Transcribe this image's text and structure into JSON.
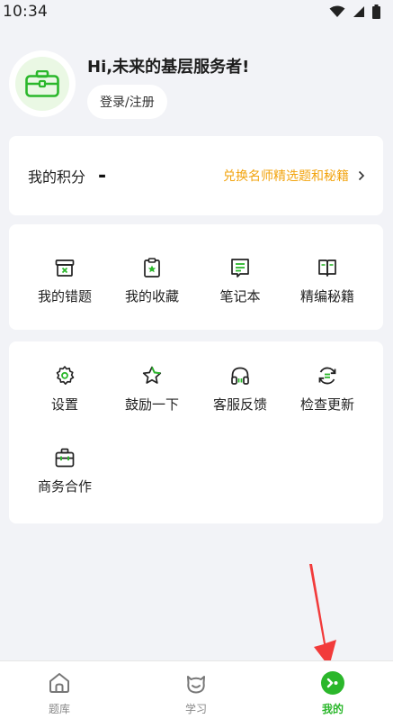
{
  "status": {
    "time": "10:34"
  },
  "profile": {
    "greeting": "Hi,未来的基层服务者!",
    "login_label": "登录/注册"
  },
  "points": {
    "label": "我的积分",
    "value": "-",
    "link": "兑换名师精选题和秘籍"
  },
  "tools": [
    {
      "label": "我的错题",
      "icon": "wrong-question-box-icon"
    },
    {
      "label": "我的收藏",
      "icon": "favorite-clipboard-icon"
    },
    {
      "label": "笔记本",
      "icon": "notebook-icon"
    },
    {
      "label": "精编秘籍",
      "icon": "open-book-icon"
    }
  ],
  "settings": [
    {
      "label": "设置",
      "icon": "gear-icon"
    },
    {
      "label": "鼓励一下",
      "icon": "star-icon"
    },
    {
      "label": "客服反馈",
      "icon": "headphones-icon"
    },
    {
      "label": "检查更新",
      "icon": "refresh-update-icon"
    },
    {
      "label": "商务合作",
      "icon": "briefcase-icon"
    }
  ],
  "tabs": [
    {
      "label": "题库",
      "icon": "home-icon"
    },
    {
      "label": "学习",
      "icon": "study-face-icon"
    },
    {
      "label": "我的",
      "icon": "profile-icon",
      "active": true
    }
  ],
  "colors": {
    "accent": "#2bb72b",
    "link": "#f2a40f",
    "arrow": "#f23b3b",
    "background": "#f2f3f7"
  }
}
